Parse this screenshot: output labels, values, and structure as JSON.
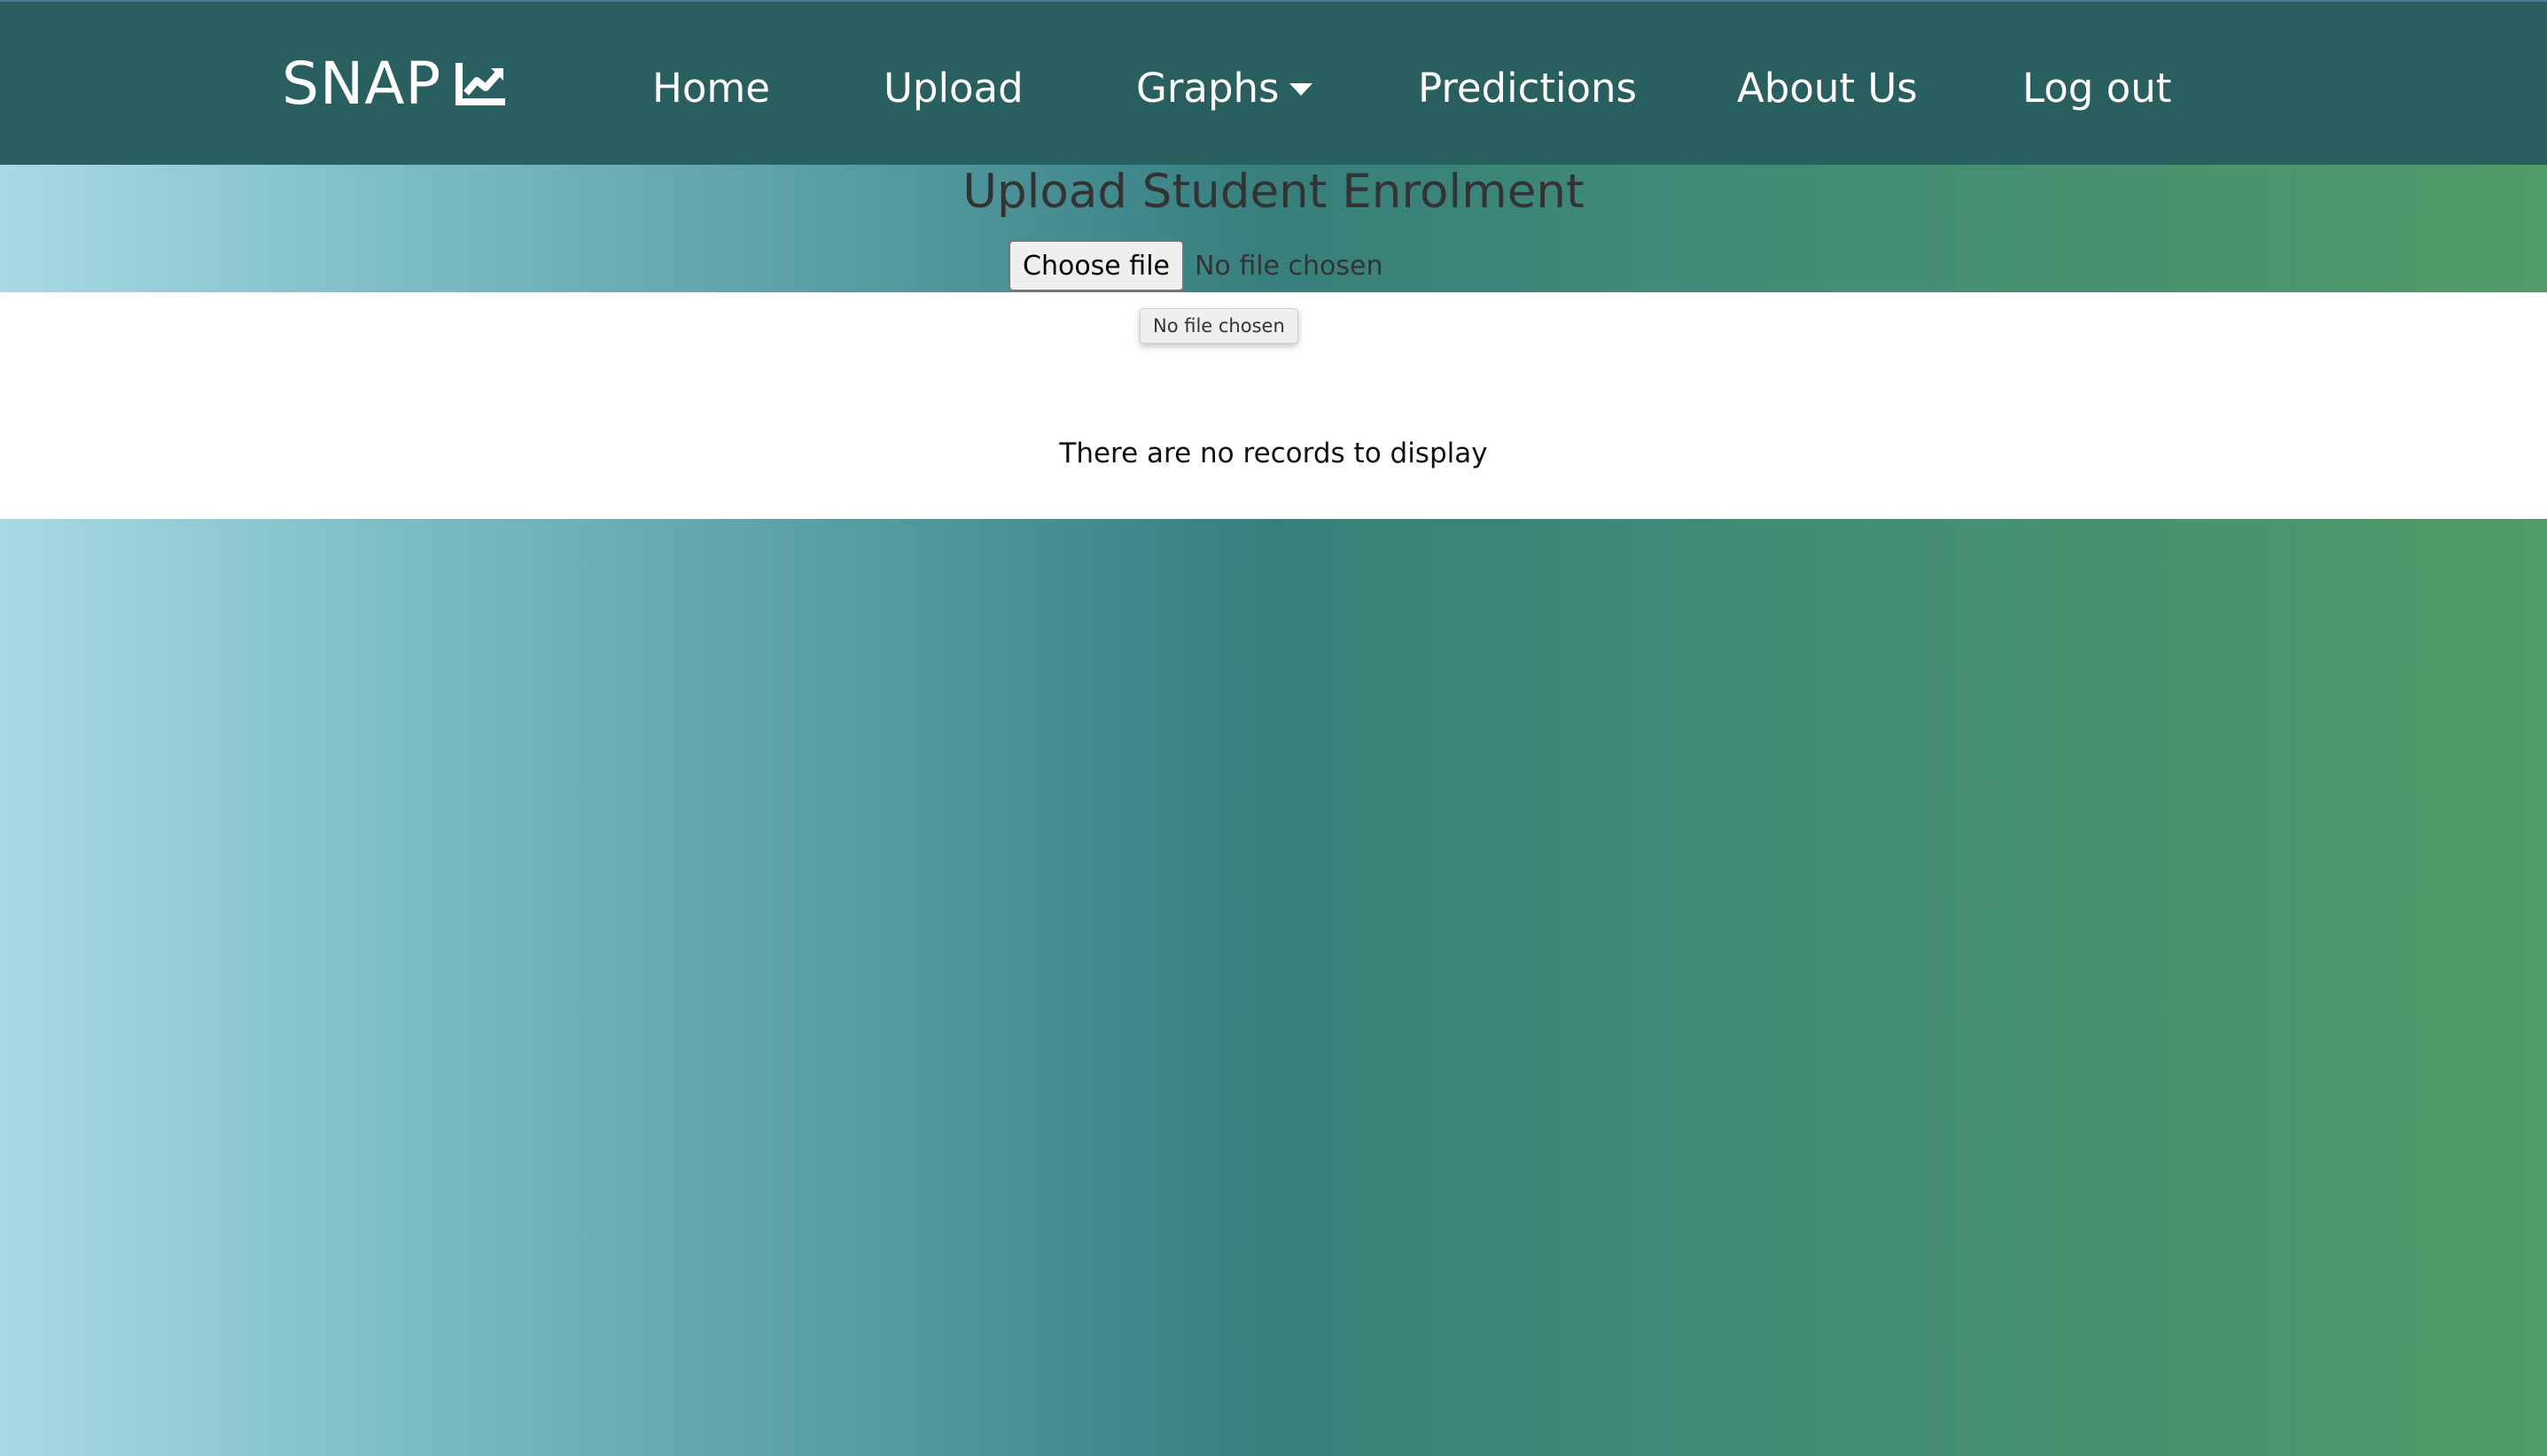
{
  "nav": {
    "brand": "SNAP",
    "brand_icon": "chart-line-icon",
    "items": [
      {
        "label": "Home"
      },
      {
        "label": "Upload"
      },
      {
        "label": "Graphs",
        "icon": "caret-down-icon"
      },
      {
        "label": "Predictions"
      },
      {
        "label": "About Us"
      },
      {
        "label": "Log out"
      }
    ]
  },
  "main": {
    "title": "Upload Student Enrolment",
    "choose_button": "Choose file",
    "file_status": "No file chosen",
    "tooltip": "No file chosen",
    "empty_message": "There are no records to display"
  },
  "colors": {
    "navbar": "#2a5f60",
    "gradient_start": "#a8dae6",
    "gradient_mid": "#387f7b",
    "gradient_end": "#529a68"
  }
}
